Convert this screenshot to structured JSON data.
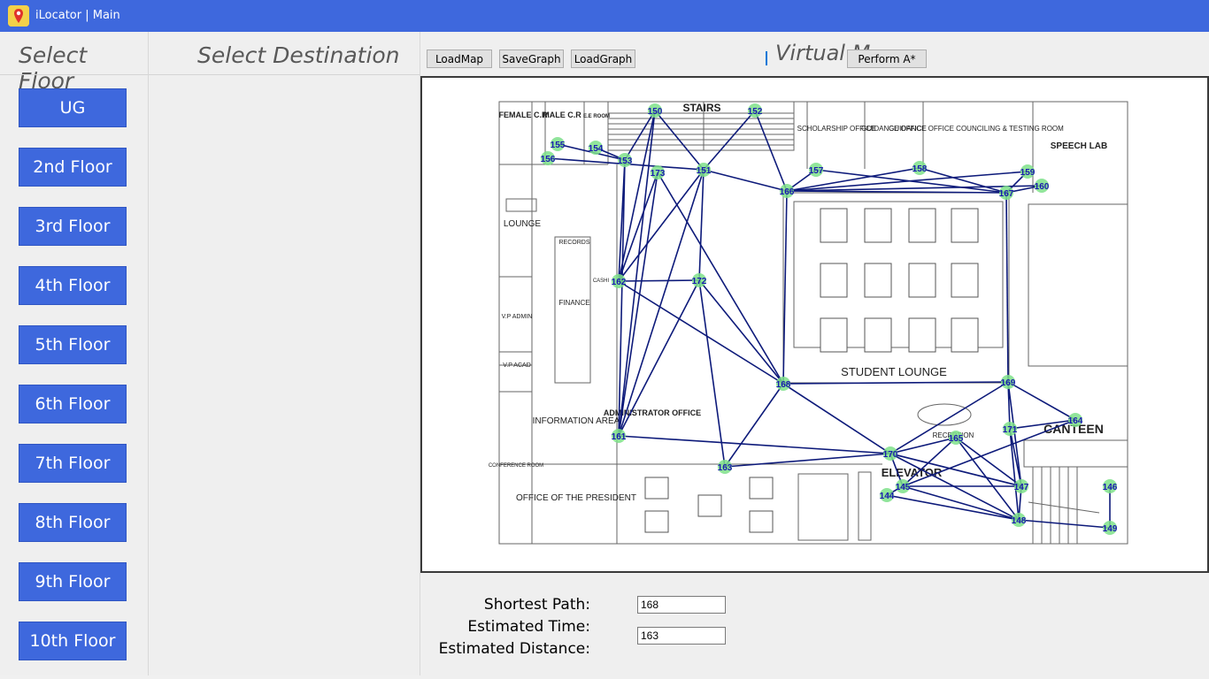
{
  "window": {
    "title": "iLocator | Main"
  },
  "left_panel": {
    "title": "Select Floor",
    "floors": [
      "UG",
      "2nd Floor",
      "3rd Floor",
      "4th Floor",
      "5th Floor",
      "6th Floor",
      "7th Floor",
      "8th Floor",
      "9th Floor",
      "10th Floor"
    ]
  },
  "middle_panel": {
    "title": "Select Destination"
  },
  "toolbar": {
    "load_map": "LoadMap",
    "save_graph": "SaveGraph",
    "load_graph": "LoadGraph",
    "perform": "Perform A*",
    "virtual_title": "Virtual M"
  },
  "map": {
    "rooms": {
      "female_cr": "FEMALE C.R",
      "male_cr": "MALE C.R",
      "ee_room": "E.E ROOM",
      "stairs": "STAIRS",
      "scholarship": "SCHOLARSHIP OFFICE",
      "guidance": "GUIDANCE OFFICE",
      "guidance_counseling": "GUIDANCE OFFICE COUNCILING & TESTING ROOM",
      "speech_lab": "SPEECH LAB",
      "lounge": "LOUNGE",
      "records": "RECORDS",
      "cashier": "CASHI",
      "finance": "FINANCE",
      "vp_admin": "V.P ADMIN",
      "vp_acad": "V.P ACAD",
      "student_lounge": "STUDENT LOUNGE",
      "information_area": "INFORMATION AREA",
      "administrator_office": "ADMINISTRATOR OFFICE",
      "conference_room": "CONFERENCE ROOM",
      "office_president": "OFFICE OF THE PRESIDENT",
      "reception": "RECEPTION",
      "canteen": "CANTEEN",
      "elevator": "ELEVATOR"
    },
    "nodes": [
      "150",
      "152",
      "155",
      "154",
      "156",
      "153",
      "173",
      "151",
      "157",
      "158",
      "159",
      "160",
      "166",
      "167",
      "162",
      "172",
      "168",
      "169",
      "164",
      "161",
      "165",
      "171",
      "170",
      "163",
      "147",
      "146",
      "145",
      "144",
      "148",
      "149"
    ],
    "edges": [
      [
        "150",
        "153"
      ],
      [
        "150",
        "162"
      ],
      [
        "150",
        "161"
      ],
      [
        "150",
        "151"
      ],
      [
        "152",
        "151"
      ],
      [
        "152",
        "166"
      ],
      [
        "155",
        "153"
      ],
      [
        "154",
        "153"
      ],
      [
        "156",
        "151"
      ],
      [
        "153",
        "162"
      ],
      [
        "153",
        "161"
      ],
      [
        "173",
        "162"
      ],
      [
        "173",
        "161"
      ],
      [
        "173",
        "168"
      ],
      [
        "151",
        "166"
      ],
      [
        "151",
        "162"
      ],
      [
        "151",
        "161"
      ],
      [
        "151",
        "172"
      ],
      [
        "162",
        "172"
      ],
      [
        "162",
        "168"
      ],
      [
        "172",
        "161"
      ],
      [
        "172",
        "163"
      ],
      [
        "172",
        "168"
      ],
      [
        "166",
        "157"
      ],
      [
        "166",
        "158"
      ],
      [
        "166",
        "159"
      ],
      [
        "166",
        "167"
      ],
      [
        "166",
        "168"
      ],
      [
        "157",
        "167"
      ],
      [
        "158",
        "167"
      ],
      [
        "159",
        "167"
      ],
      [
        "160",
        "167"
      ],
      [
        "166",
        "160"
      ],
      [
        "167",
        "169"
      ],
      [
        "168",
        "169"
      ],
      [
        "168",
        "170"
      ],
      [
        "168",
        "163"
      ],
      [
        "161",
        "170"
      ],
      [
        "169",
        "170"
      ],
      [
        "169",
        "171"
      ],
      [
        "169",
        "147"
      ],
      [
        "169",
        "164"
      ],
      [
        "171",
        "164"
      ],
      [
        "171",
        "147"
      ],
      [
        "164",
        "145"
      ],
      [
        "170",
        "147"
      ],
      [
        "170",
        "148"
      ],
      [
        "170",
        "145"
      ],
      [
        "163",
        "170"
      ],
      [
        "165",
        "147"
      ],
      [
        "165",
        "148"
      ],
      [
        "165",
        "145"
      ],
      [
        "165",
        "170"
      ],
      [
        "147",
        "145"
      ],
      [
        "147",
        "148"
      ],
      [
        "148",
        "144"
      ],
      [
        "145",
        "148"
      ],
      [
        "146",
        "149"
      ],
      [
        "144",
        "145"
      ],
      [
        "148",
        "149"
      ],
      [
        "171",
        "148"
      ]
    ]
  },
  "results": {
    "shortest_path_label": "Shortest Path:",
    "estimated_time_label": "Estimated Time:",
    "estimated_distance_label": "Estimated Distance:",
    "shortest_path_value": "168",
    "estimated_time_value": "163"
  },
  "colors": {
    "titlebar": "#3e68dd",
    "button": "#3e68dd",
    "edge": "#0d1a7a",
    "node": "#7ee18a",
    "node_label": "#1a1ab0"
  }
}
